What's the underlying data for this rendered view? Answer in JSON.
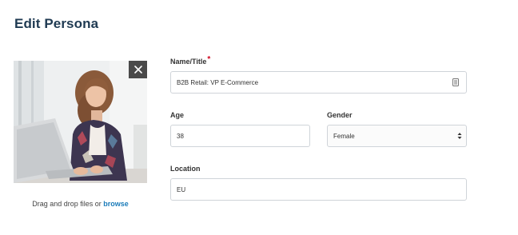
{
  "page": {
    "title": "Edit Persona"
  },
  "photo": {
    "alt": "Persona photo of a woman working on a laptop",
    "remove_icon": "close-icon"
  },
  "dropzone": {
    "text": "Drag and drop files or",
    "browse_label": "browse"
  },
  "form": {
    "name": {
      "label": "Name/Title",
      "required_mark": "*",
      "value": "B2B Retail: VP E-Commerce",
      "icon": "contact-card-icon"
    },
    "age": {
      "label": "Age",
      "value": "38"
    },
    "gender": {
      "label": "Gender",
      "value": "Female",
      "icon": "select-arrows-icon"
    },
    "location": {
      "label": "Location",
      "value": "EU"
    }
  },
  "colors": {
    "title": "#1f3a52",
    "link": "#1a7bb9",
    "required": "#d0021b",
    "border": "#cfd4d9",
    "remove_button_bg": "#4a4a4a"
  }
}
